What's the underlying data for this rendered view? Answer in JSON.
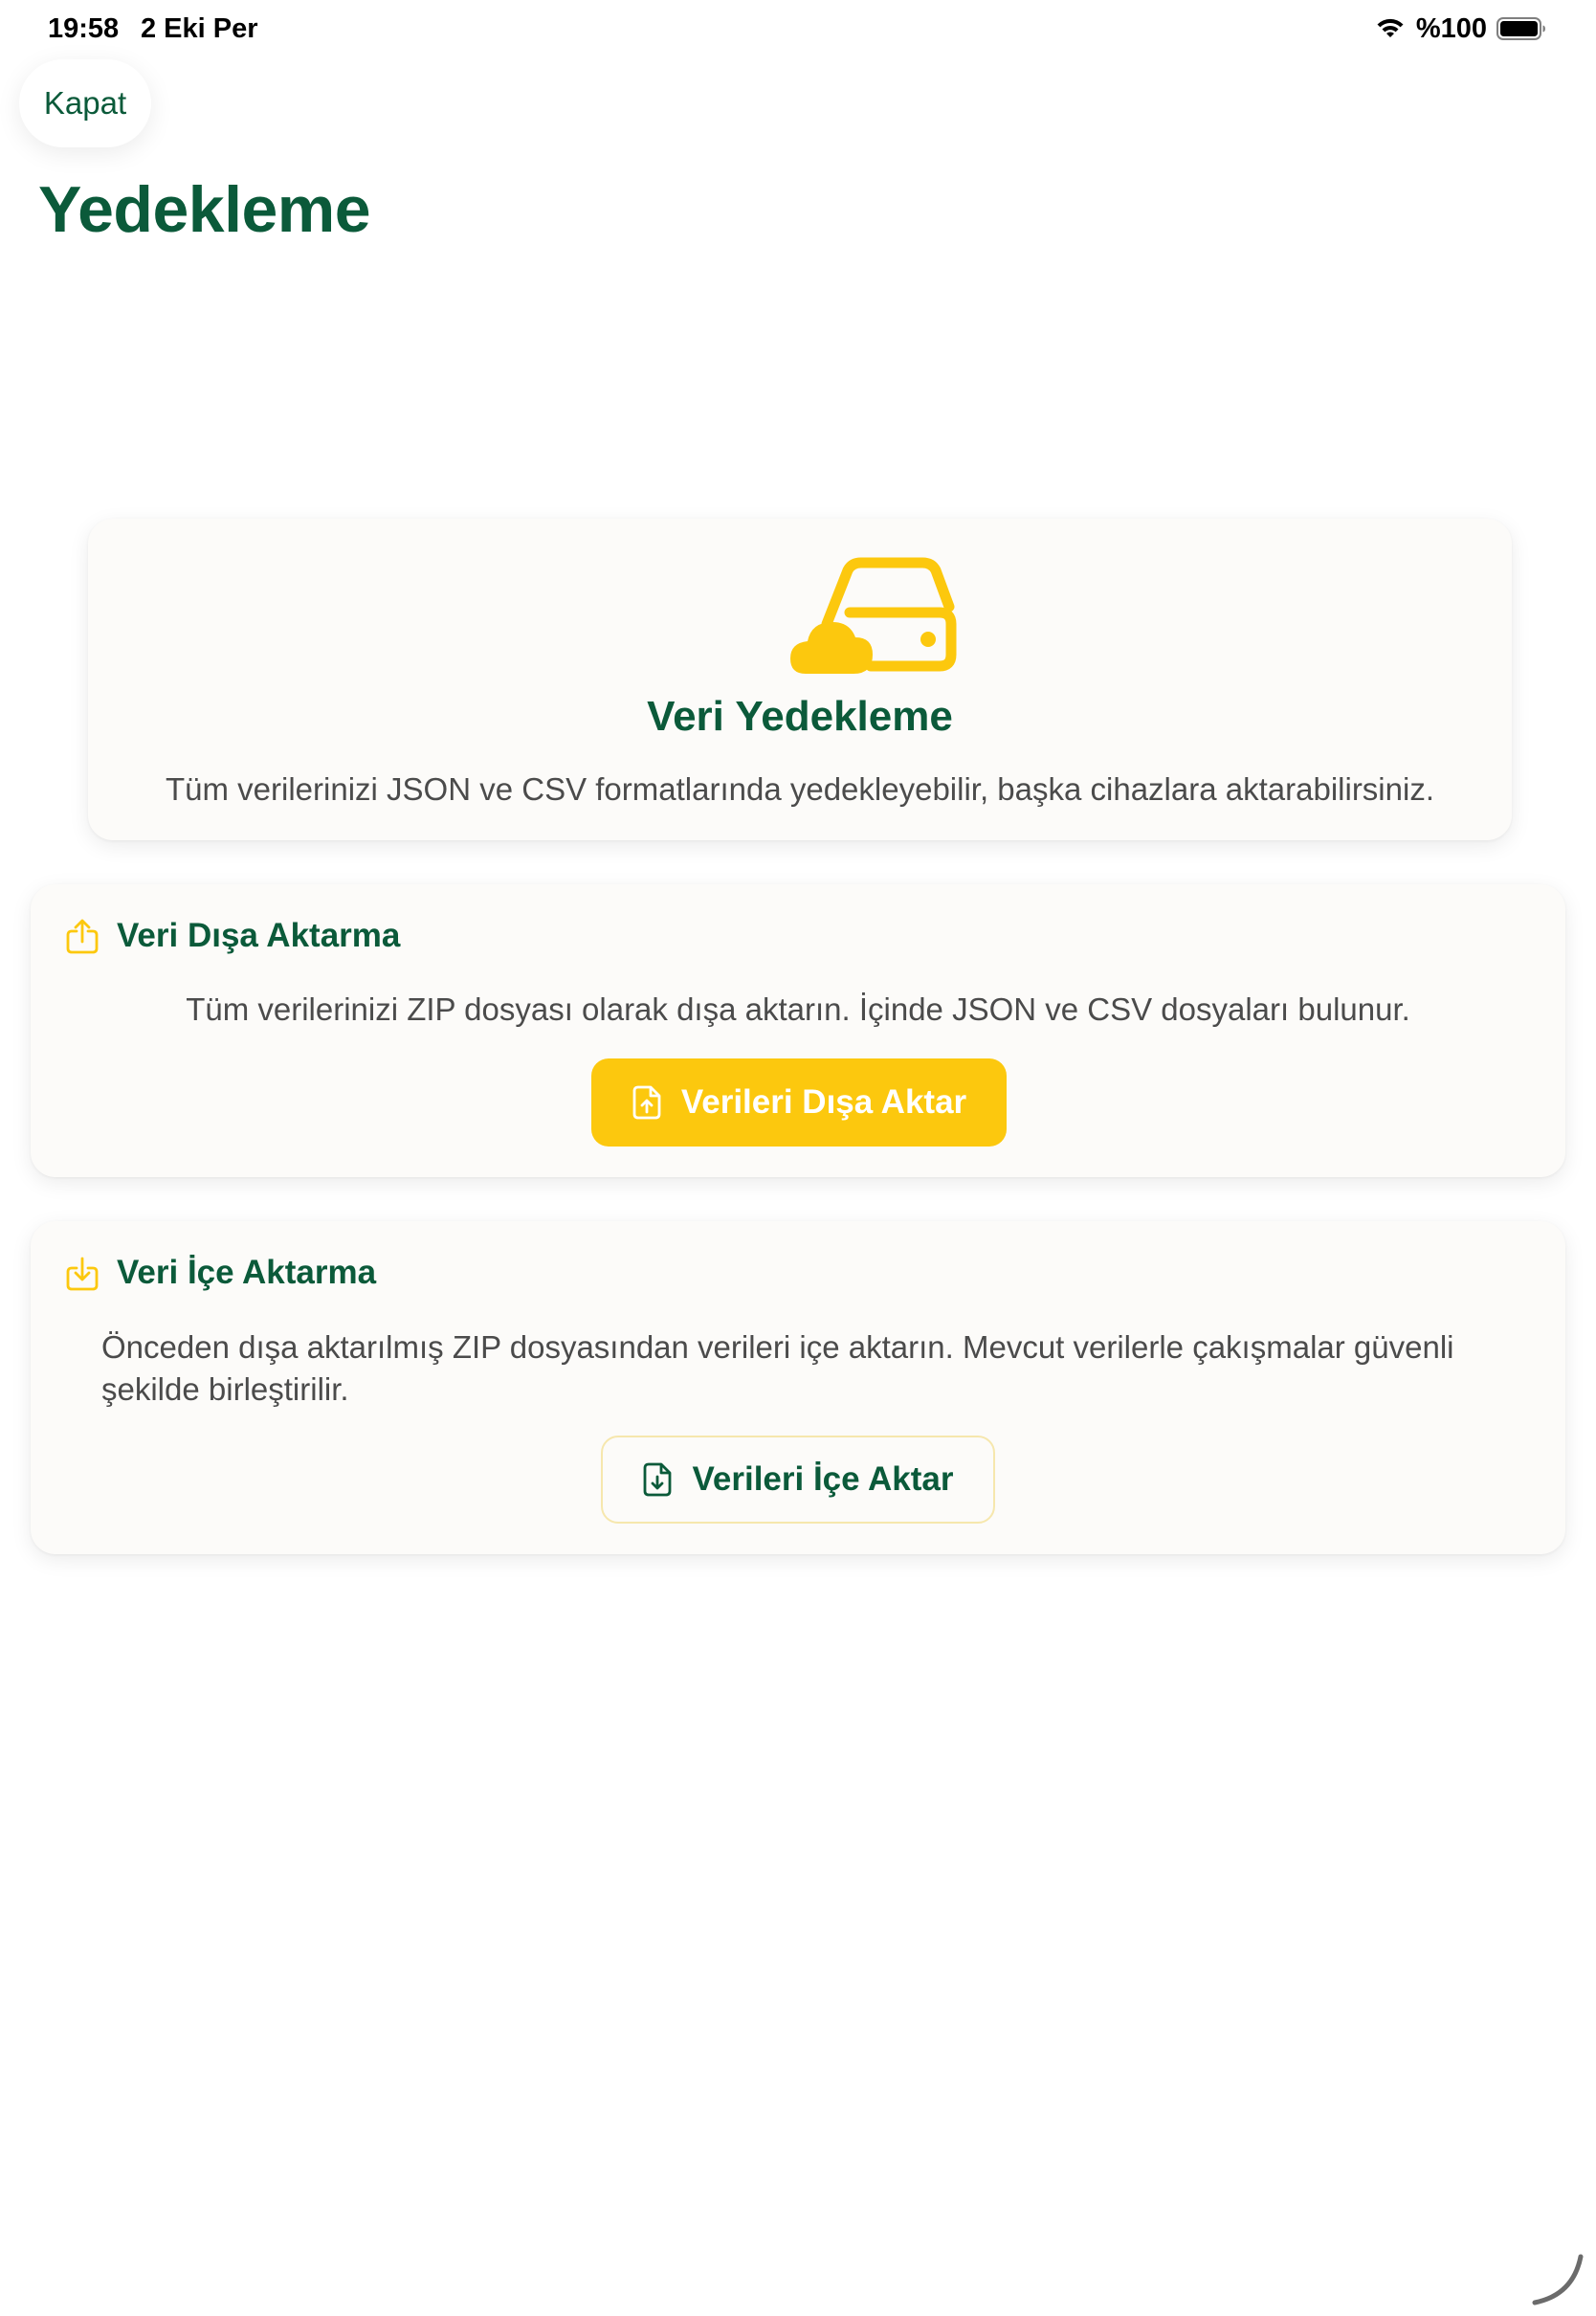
{
  "status_bar": {
    "time": "19:58",
    "date": "2 Eki Per",
    "battery": "%100",
    "icons": [
      "wifi-icon",
      "battery-icon"
    ]
  },
  "header": {
    "close_label": "Kapat",
    "title": "Yedekleme"
  },
  "hero": {
    "icon": "cloud-drive-icon",
    "title": "Veri Yedekleme",
    "description": "Tüm verilerinizi JSON ve CSV formatlarında yedekleyebilir, başka cihazlara aktarabilirsiniz."
  },
  "export_section": {
    "icon": "share-upload-icon",
    "title": "Veri Dışa Aktarma",
    "description": "Tüm verilerinizi ZIP dosyası olarak dışa aktarın. İçinde JSON ve CSV dosyaları bulunur.",
    "button_icon": "file-upload-icon",
    "button_label": "Verileri Dışa Aktar"
  },
  "import_section": {
    "icon": "tray-download-icon",
    "title": "Veri İçe Aktarma",
    "description": "Önceden dışa aktarılmış ZIP dosyasından verileri içe aktarın. Mevcut verilerle çakışmalar güvenli şekilde birleştirilir.",
    "button_icon": "file-download-icon",
    "button_label": "Verileri İçe Aktar"
  },
  "colors": {
    "brand_green": "#0b5a3a",
    "accent_yellow": "#fcc80e",
    "card_background": "#fcfbf9",
    "body_text": "#4b4b4b"
  }
}
